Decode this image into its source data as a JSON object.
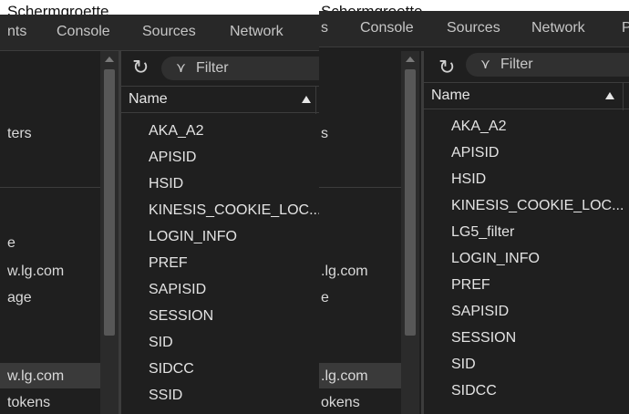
{
  "window_title": "Schermgroette",
  "left_window": {
    "tabs": [
      "nts",
      "Console",
      "Sources",
      "Network"
    ],
    "sidebar": {
      "items": [
        "ters",
        "e",
        "w.lg.com",
        "age",
        "w.lg.com",
        "tokens"
      ]
    },
    "filter": {
      "placeholder": "Filter"
    },
    "column": {
      "name": "Name"
    },
    "cookies": [
      "AKA_A2",
      "APISID",
      "HSID",
      "KINESIS_COOKIE_LOC...",
      "LOGIN_INFO",
      "PREF",
      "SAPISID",
      "SESSION",
      "SID",
      "SIDCC",
      "SSID"
    ]
  },
  "right_window": {
    "tabs": [
      "s",
      "Console",
      "Sources",
      "Network",
      "P"
    ],
    "sidebar": {
      "items": [
        "s",
        ".lg.com",
        "e",
        ".lg.com",
        "okens"
      ]
    },
    "filter": {
      "placeholder": "Filter"
    },
    "column": {
      "name": "Name"
    },
    "cookies": [
      "AKA_A2",
      "APISID",
      "HSID",
      "KINESIS_COOKIE_LOC...",
      "LG5_filter",
      "LOGIN_INFO",
      "PREF",
      "SAPISID",
      "SESSION",
      "SID",
      "SIDCC"
    ]
  },
  "icons": {
    "refresh": "refresh-icon",
    "filter": "filter-icon",
    "sort": "sort-ascending-icon"
  }
}
